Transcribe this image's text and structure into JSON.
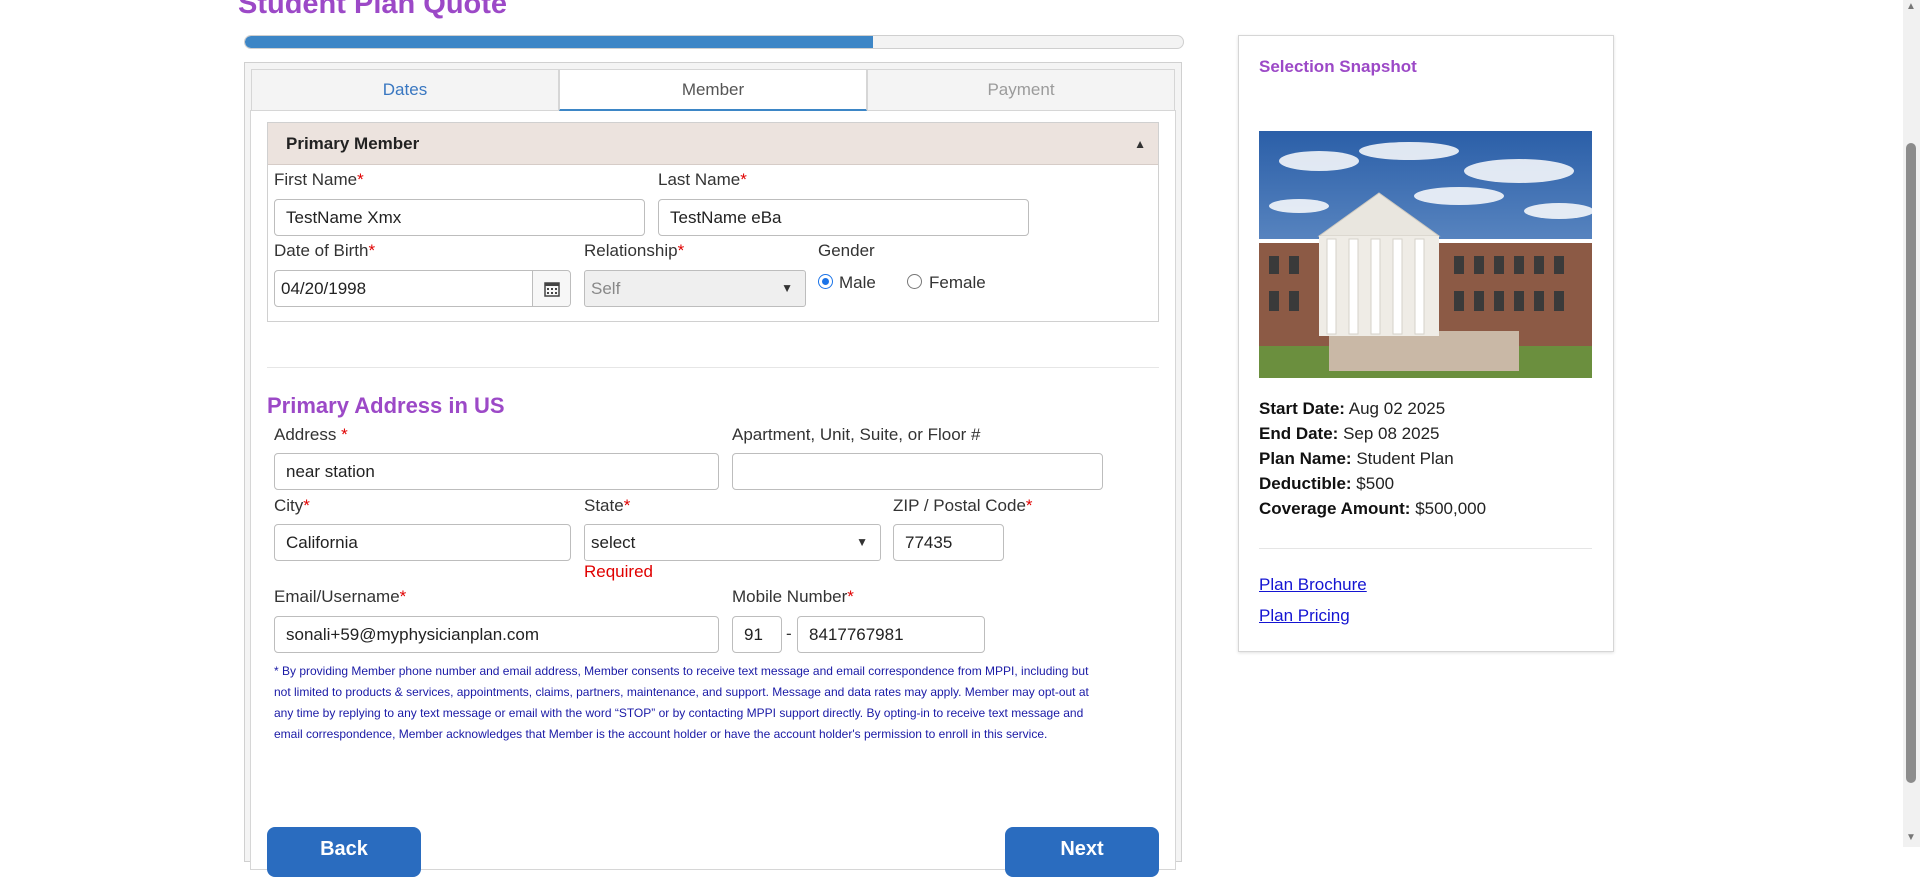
{
  "page": {
    "title": "Student Plan Quote",
    "progress_percent": 67
  },
  "tabs": [
    {
      "label": "Dates"
    },
    {
      "label": "Member"
    },
    {
      "label": "Payment"
    }
  ],
  "primary_member": {
    "header": "Primary Member",
    "first_name": {
      "label": "First Name",
      "value": "TestName Xmx"
    },
    "last_name": {
      "label": "Last Name",
      "value": "TestName eBa"
    },
    "dob": {
      "label": "Date of Birth",
      "value": "04/20/1998"
    },
    "relationship": {
      "label": "Relationship",
      "value": "Self"
    },
    "gender": {
      "label": "Gender",
      "options": [
        "Male",
        "Female"
      ],
      "selected": "Male"
    }
  },
  "address": {
    "title": "Primary Address in US",
    "address": {
      "label": "Address",
      "value": "near station"
    },
    "apartment": {
      "label": "Apartment, Unit, Suite, or Floor #",
      "value": ""
    },
    "city": {
      "label": "City",
      "value": "California"
    },
    "state": {
      "label": "State",
      "value": "select",
      "error": "Required"
    },
    "zip": {
      "label": "ZIP / Postal Code",
      "value": "77435"
    },
    "email": {
      "label": "Email/Username",
      "value": "sonali+59@myphysicianplan.com"
    },
    "mobile": {
      "label": "Mobile Number",
      "country_code": "91",
      "separator": "-",
      "number": "8417767981"
    },
    "required_marker": "*"
  },
  "disclaimer": "* By providing Member phone number and email address, Member consents to receive text message and email correspondence from MPPI, including but not limited to products & services, appointments, claims, partners, maintenance, and support. Message and data rates may apply. Member may opt-out at any time by replying to any text message or email with the word “STOP” or by contacting MPPI support directly. By opting-in to receive text message and email correspondence, Member acknowledges that Member is the account holder or have the account holder's permission to enroll in this service.",
  "buttons": {
    "back": "Back",
    "next": "Next"
  },
  "snapshot": {
    "title": "Selection Snapshot",
    "items": [
      {
        "label": "Start Date:",
        "value": "Aug 02 2025"
      },
      {
        "label": "End Date:",
        "value": "Sep 08 2025"
      },
      {
        "label": "Plan Name:",
        "value": "Student Plan"
      },
      {
        "label": "Deductible:",
        "value": "$500"
      },
      {
        "label": "Coverage Amount:",
        "value": "$500,000"
      }
    ],
    "links": [
      "Plan Brochure",
      "Plan Pricing"
    ]
  },
  "colors": {
    "accent_purple": "#9c49c7",
    "primary_blue": "#2a6cbf",
    "progress_blue": "#3d86c6",
    "error_red": "#e00000"
  }
}
